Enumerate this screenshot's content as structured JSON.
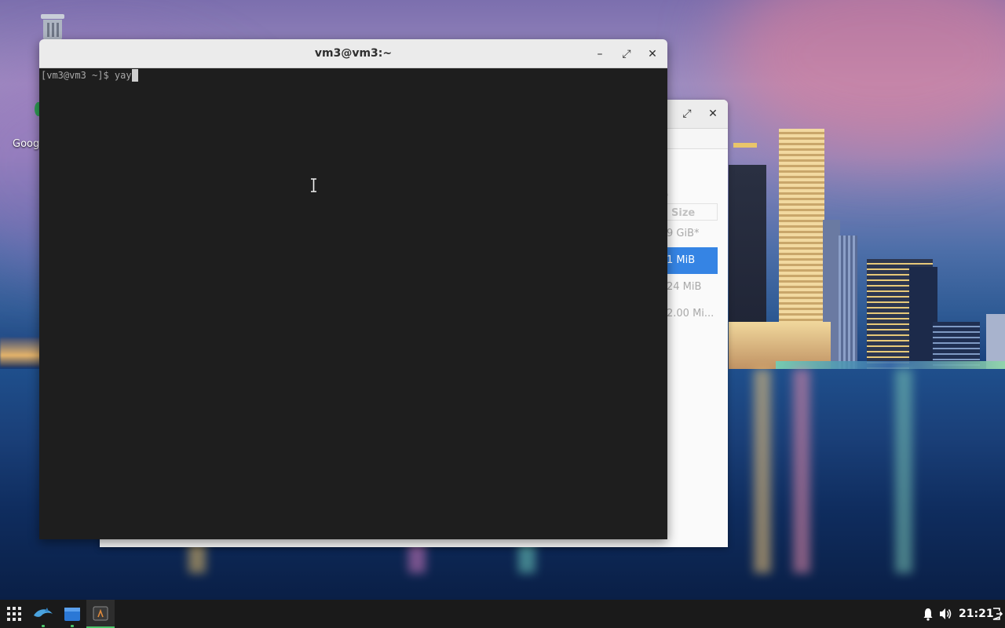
{
  "terminal": {
    "title": "vm3@vm3:~",
    "prompt": "[vm3@vm3 ~]$ ",
    "command": "yay",
    "minimize_glyph": "–",
    "maximize_glyph": "⤢",
    "close_glyph": "✕"
  },
  "back_window": {
    "maximize_glyph": "⤢",
    "close_glyph": "✕",
    "size_column_header": "Size",
    "partitions": [
      {
        "size": "9 GiB*",
        "selected": false
      },
      {
        "size": "1 MiB",
        "selected": true
      },
      {
        "size": "24 MiB",
        "selected": false
      },
      {
        "size": "2.00 Mi...",
        "selected": false
      }
    ],
    "faint_mark": "\\"
  },
  "desktop": {
    "chrome_label": "Goog"
  },
  "taskbar": {
    "clock": "21:21",
    "apps": [
      "app-grid-icon",
      "kde-dolphin-like-icon",
      "file-manager-icon",
      "terminal-icon"
    ]
  },
  "colors": {
    "accent_blue": "#3584e4",
    "active_indicator": "#4bc46a",
    "terminal_bg": "#1e1e1e"
  }
}
